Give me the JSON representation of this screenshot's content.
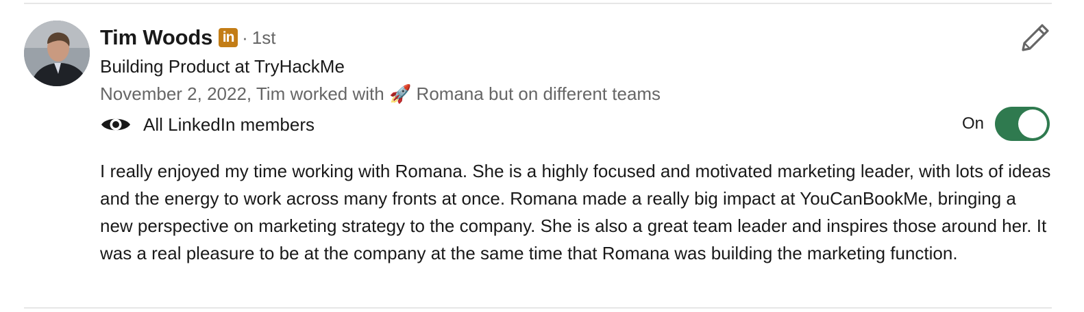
{
  "recommendation": {
    "author_name": "Tim Woods",
    "network_badge_text": "in",
    "separator": "·",
    "connection_degree": "1st",
    "headline": "Building Product at TryHackMe",
    "meta_text": "November 2, 2022, Tim worked with 🚀 Romana but on different teams",
    "visibility_label": "All LinkedIn members",
    "toggle_label": "On",
    "toggle_state": "on",
    "body": "I really enjoyed my time working with Romana. She is a highly focused and motivated marketing leader, with lots of ideas and the energy to work across many fronts at once. Romana made a really big impact at YouCanBookMe, bringing a new perspective on marketing strategy to the company. She is also a great team leader and inspires those around her. It was a real pleasure to be at the company at the same time that Romana was building the marketing function."
  },
  "icons": {
    "visibility": "eye-icon",
    "edit": "pencil-icon",
    "badge": "linkedin-icon"
  },
  "colors": {
    "badge": "#c37d16",
    "toggle_on": "#2f7a4f",
    "secondary_text": "#666666",
    "primary_text": "#191919"
  }
}
